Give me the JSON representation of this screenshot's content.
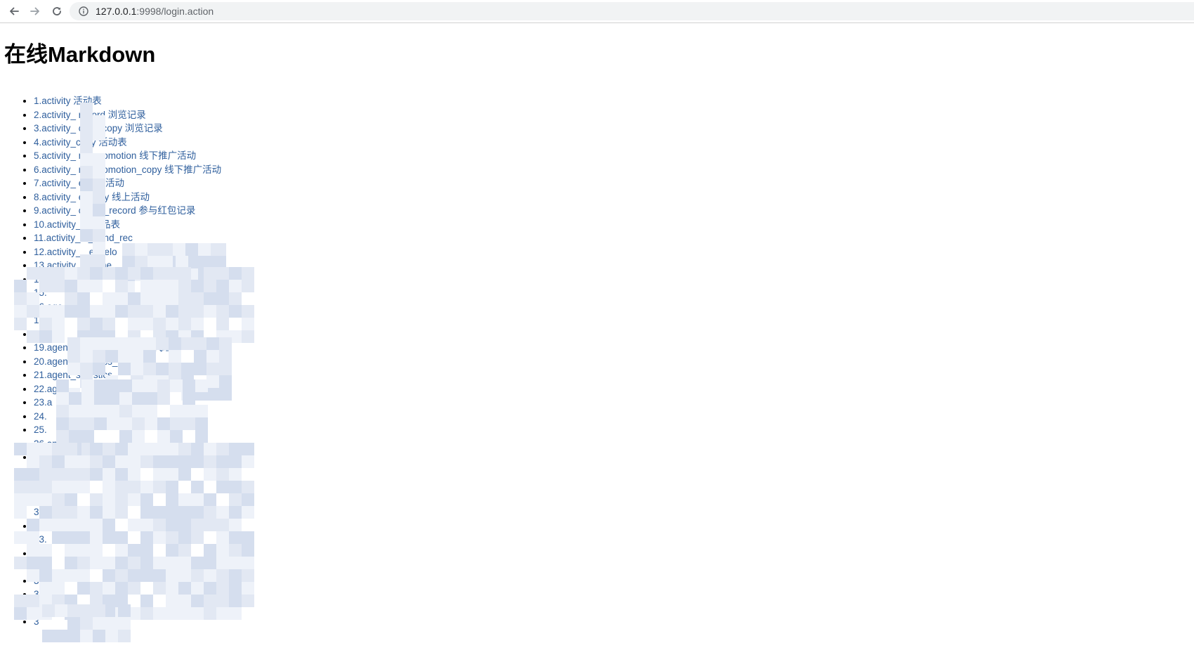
{
  "browser": {
    "url_host": "127.0.0.1",
    "url_rest": ":9998/login.action",
    "icons": {
      "back": "arrow-left-icon",
      "forward": "arrow-right-icon",
      "reload": "reload-icon",
      "info": "info-circle-icon"
    }
  },
  "page": {
    "title": "在线Markdown"
  },
  "toc": [
    "1.activity 活动表",
    "2.activity_       record 浏览记录",
    "3.activity_        cord_copy 浏览记录",
    "4.activity_copy 活动表",
    "5.activity_     ne_promotion 线下推广活动",
    "6.activity_     ne_promotion_copy 线下推广活动",
    "7.activity_     e 线上活动",
    "8.activity_     e_copy 线上活动",
    "9.activity_     cipate_record 参与红包记录",
    "10.activity_   e 奖品表",
    "11.activity_   e_send_rec",
    "12.activity_   _envelo",
    "13.activity_   k_time",
    "14.",
    "15.",
    "16.age",
    "17.",
    "18.",
    "19.agent_statistics_investor 代理商+",
    "20.agent_statistics_rechar",
    "21.agent_statistics",
    "22.ag",
    "23.a",
    "24.",
    "25.",
    "26.ap    rsion",
    "27.",
    "28.",
    "29.",
    "30.",
    "31.",
    "32.",
    "33.",
    "34.",
    "35.",
    "36.",
    "37.",
    "38.",
    "3"
  ],
  "colors": {
    "link": "#2f5f9d",
    "redaction_light": "#eef2f9",
    "redaction_mid": "#e2e8f3",
    "redaction_dark": "#d5deee"
  }
}
